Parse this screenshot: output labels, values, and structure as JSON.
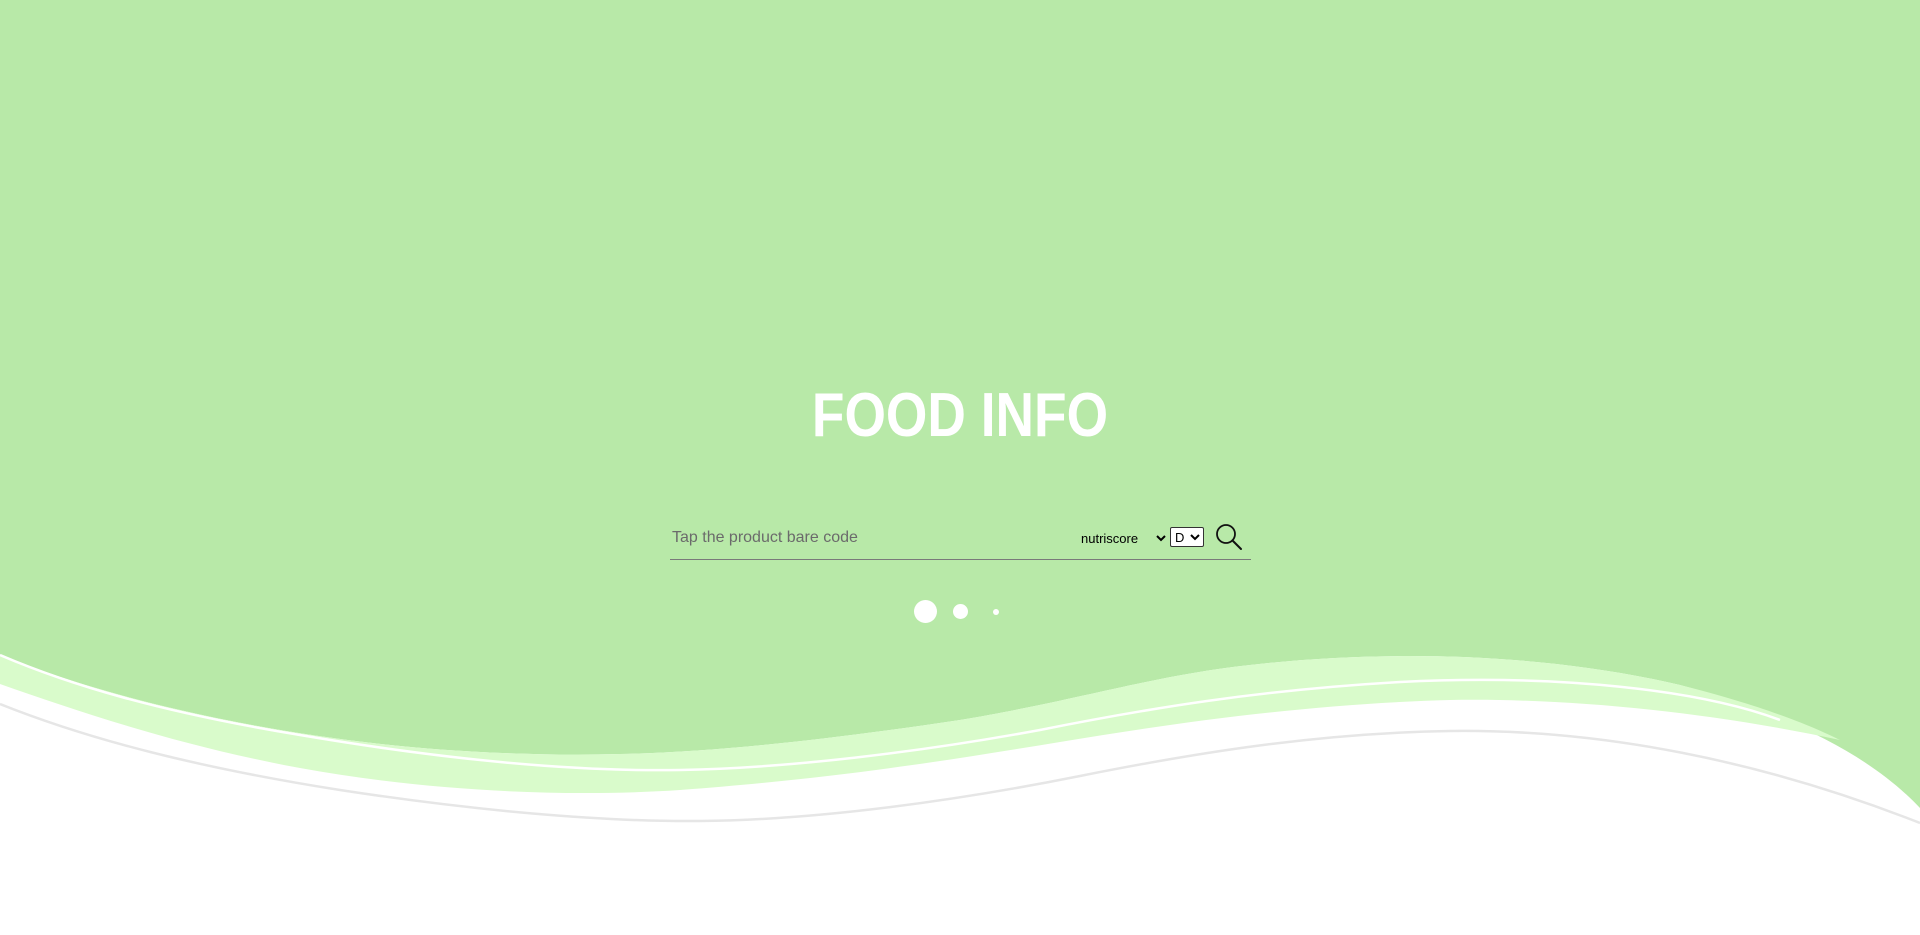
{
  "header": {
    "title": "FOOD INFO"
  },
  "search": {
    "placeholder": "Tap the product bare code",
    "value": "",
    "button_icon": "search-icon"
  },
  "filters": {
    "score_type": {
      "selected": "nutriscore",
      "options": [
        "nutriscore"
      ]
    },
    "grade": {
      "selected": "D",
      "options": [
        "D"
      ]
    }
  },
  "carousel": {
    "dot_count": 3,
    "active_index": 0
  },
  "colors": {
    "background": "#b8e9a8",
    "wave_light": "#d9fbcb",
    "wave_line_white": "#ffffff",
    "wave_line_gray": "#e6e6e6",
    "text": "#ffffff"
  }
}
